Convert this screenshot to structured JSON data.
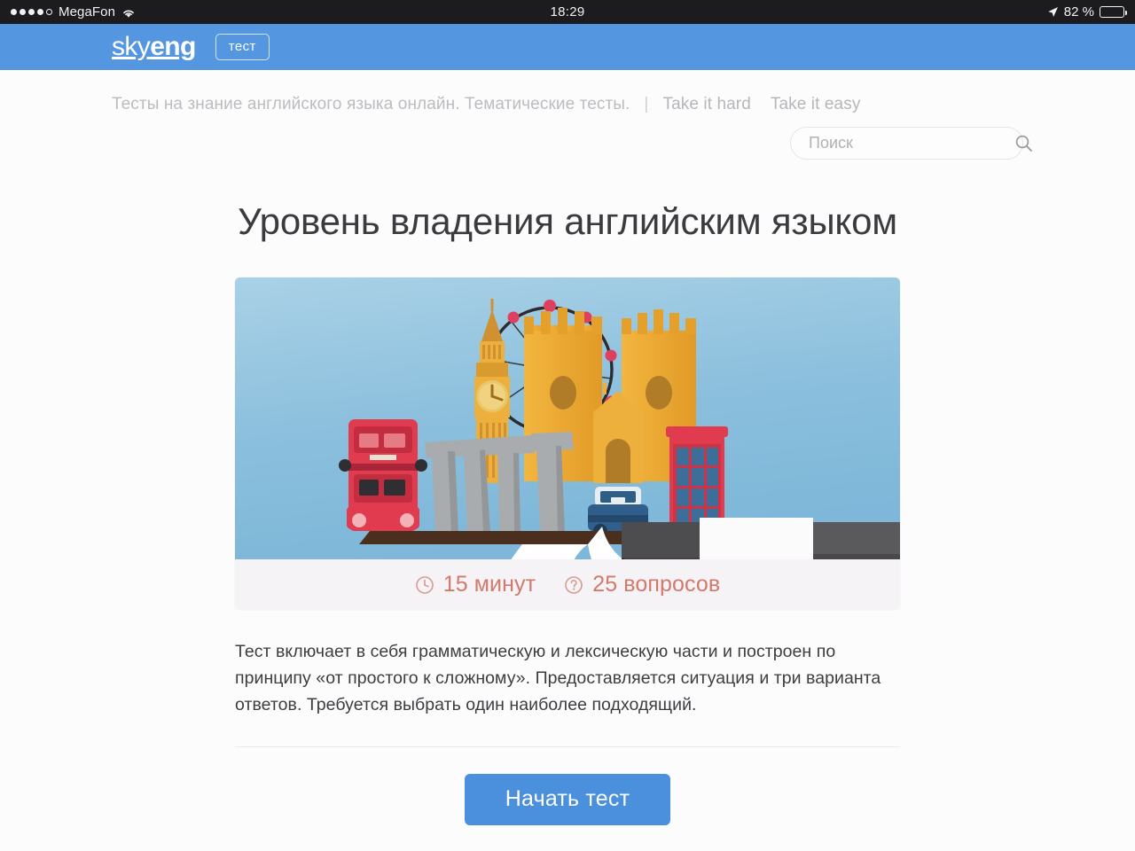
{
  "status_bar": {
    "carrier": "MegaFon",
    "signal_dots_filled": 4,
    "signal_dots_total": 5,
    "wifi_icon": "wifi-icon",
    "time": "18:29",
    "location_icon": "location-arrow-icon",
    "battery_percent": "82 %",
    "battery_level": 82,
    "background_color": "#1c1c1e"
  },
  "header": {
    "logo_part1": "sky",
    "logo_part2": "eng",
    "badge_label": "тест",
    "background_color": "#5596e0"
  },
  "nav": {
    "tagline": "Тесты на знание английского языка онлайн. Тематические тесты.",
    "separator": "|",
    "links": [
      {
        "label": "Take it hard"
      },
      {
        "label": "Take it easy"
      }
    ]
  },
  "search": {
    "placeholder": "Поиск",
    "value": "",
    "icon": "search-icon"
  },
  "main": {
    "title": "Уровень владения английским языком",
    "meta": [
      {
        "icon": "clock-icon",
        "label": "15 минут"
      },
      {
        "icon": "question-mark-circle-icon",
        "label": "25 вопросов"
      }
    ],
    "meta_color": "#d17a6c",
    "description": "Тест включает в себя грамматическую и лексическую части и построен по принципу «от простого к сложному». Предоставляется ситуация и три варианта ответов. Требуется выбрать один наиболее подходящий.",
    "cta_label": "Начать тест",
    "cta_color": "#4a90dd"
  },
  "illustration": {
    "alt": "london-landmarks-on-tray-illustration",
    "sky_color": "#8fc1de",
    "landmark_color": "#f0a830",
    "bus_color": "#e03b4e",
    "phone_booth_color": "#e03b4e",
    "stone_color": "#a5a8ab",
    "tray_color": "#4a2f1f",
    "sleeve_color": "#4d4d50"
  }
}
